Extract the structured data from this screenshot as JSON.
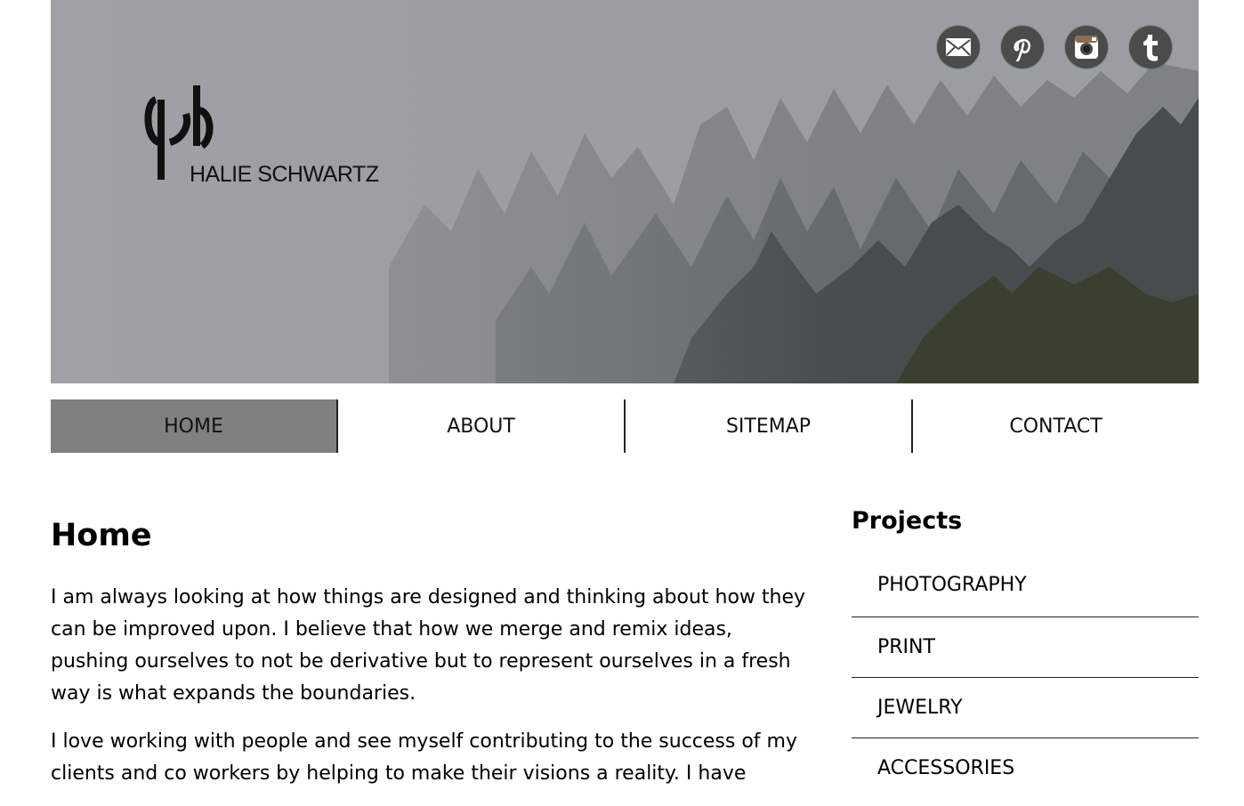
{
  "header": {
    "logo_text": "HALIE SCHWARTZ",
    "social": [
      {
        "icon": "email-icon"
      },
      {
        "icon": "pinterest-icon"
      },
      {
        "icon": "instagram-icon"
      },
      {
        "icon": "tumblr-icon"
      }
    ]
  },
  "nav": {
    "items": [
      {
        "label": "HOME",
        "active": true
      },
      {
        "label": "ABOUT"
      },
      {
        "label": "SITEMAP"
      },
      {
        "label": "CONTACT"
      }
    ]
  },
  "main": {
    "title": "Home",
    "paragraphs": [
      "I am always looking at how things are designed and thinking about how they can be improved upon. I believe that how we merge and remix ideas, pushing ourselves to not be derivative but to represent ourselves in a fresh way is what expands the boundaries.",
      "I love working with people and see myself contributing to the success of my clients and co workers by helping to make their visions a reality. I have"
    ]
  },
  "sidebar": {
    "title": "Projects",
    "items": [
      "PHOTOGRAPHY",
      "PRINT",
      "JEWELRY",
      "ACCESSORIES"
    ]
  },
  "colors": {
    "nav_active": "#808080",
    "social_bg": "#4b4b4b",
    "hero_fog": "#9ea1a5"
  }
}
